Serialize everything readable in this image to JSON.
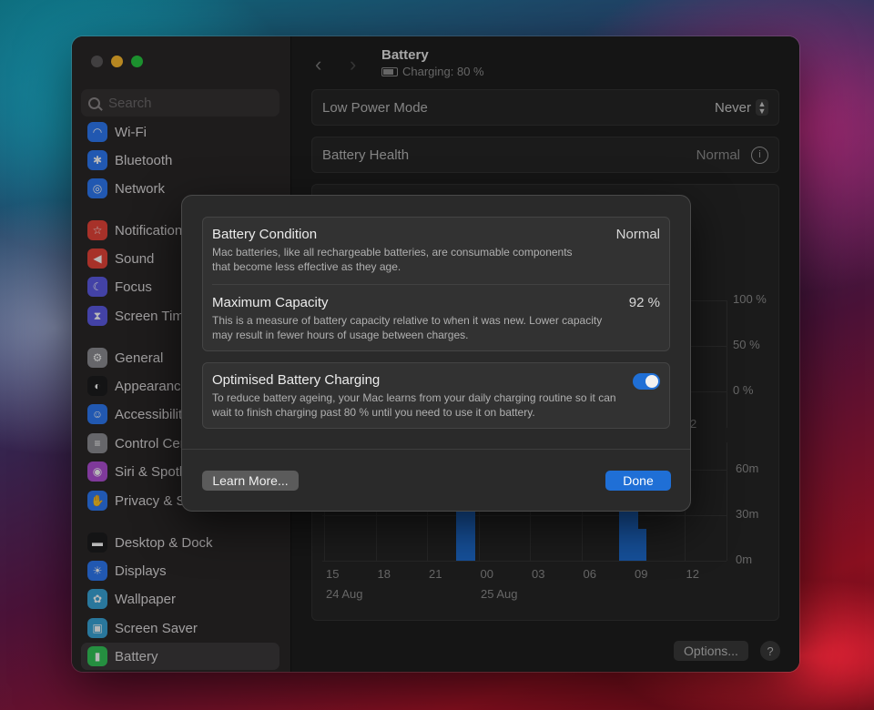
{
  "window": {
    "title": "Battery",
    "subtitle": "Charging: 80 %"
  },
  "sidebar": {
    "search_placeholder": "Search",
    "items": [
      {
        "label": "Wi-Fi",
        "icon": "wifi-icon",
        "color": "#2f7bf5"
      },
      {
        "label": "Bluetooth",
        "icon": "bluetooth-icon",
        "color": "#2f7bf5"
      },
      {
        "label": "Network",
        "icon": "globe-icon",
        "color": "#2f7bf5"
      },
      {
        "label": "Notifications",
        "icon": "bell-icon",
        "color": "#e8443a"
      },
      {
        "label": "Sound",
        "icon": "speaker-icon",
        "color": "#e8443a"
      },
      {
        "label": "Focus",
        "icon": "moon-icon",
        "color": "#5e5ce6"
      },
      {
        "label": "Screen Time",
        "icon": "hourglass-icon",
        "color": "#5e5ce6"
      },
      {
        "label": "General",
        "icon": "gear-icon",
        "color": "#8e8e93"
      },
      {
        "label": "Appearance",
        "icon": "appearance-icon",
        "color": "#1c1c1e"
      },
      {
        "label": "Accessibility",
        "icon": "accessibility-icon",
        "color": "#2f7bf5"
      },
      {
        "label": "Control Centre",
        "icon": "toggles-icon",
        "color": "#8e8e93"
      },
      {
        "label": "Siri & Spotlight",
        "icon": "siri-icon",
        "color": "#b04fd6"
      },
      {
        "label": "Privacy & Security",
        "icon": "hand-icon",
        "color": "#2f7bf5"
      },
      {
        "label": "Desktop & Dock",
        "icon": "dock-icon",
        "color": "#1c1c1e"
      },
      {
        "label": "Displays",
        "icon": "sun-icon",
        "color": "#2f7bf5"
      },
      {
        "label": "Wallpaper",
        "icon": "flower-icon",
        "color": "#3aa6d8"
      },
      {
        "label": "Screen Saver",
        "icon": "screensaver-icon",
        "color": "#3aa6d8"
      },
      {
        "label": "Battery",
        "icon": "battery-icon",
        "color": "#34c759"
      }
    ]
  },
  "settings": {
    "low_power": {
      "label": "Low Power Mode",
      "value": "Never"
    },
    "health": {
      "label": "Battery Health",
      "value": "Normal"
    },
    "segment_fragment": "s",
    "options_button": "Options...",
    "help_button": "?"
  },
  "chart_data": [
    {
      "type": "line",
      "y_ticks": [
        "100 %",
        "50 %",
        "0 %"
      ],
      "x_tick_fragment": "2"
    },
    {
      "type": "bar",
      "y_ticks": [
        "60m",
        "30m",
        "0m"
      ],
      "x_ticks": [
        "15",
        "18",
        "21",
        "00",
        "03",
        "06",
        "09",
        "12"
      ],
      "date_labels": [
        "24 Aug",
        "25 Aug"
      ],
      "ylim": [
        0,
        60
      ],
      "bar_color": "#1f6fd6",
      "bars": [
        {
          "x": 23.0,
          "y": 60
        },
        {
          "x": 23.5,
          "y": 26
        },
        {
          "x": 8.5,
          "y": 32
        },
        {
          "x": 9.0,
          "y": 60
        },
        {
          "x": 9.5,
          "y": 16
        }
      ]
    }
  ],
  "sheet": {
    "condition": {
      "title": "Battery Condition",
      "value": "Normal",
      "description": "Mac batteries, like all rechargeable batteries, are consumable components that become less effective as they age."
    },
    "capacity": {
      "title": "Maximum Capacity",
      "value": "92 %",
      "description": "This is a measure of battery capacity relative to when it was new. Lower capacity may result in fewer hours of usage between charges."
    },
    "optimised": {
      "title": "Optimised Battery Charging",
      "enabled": true,
      "description": "To reduce battery ageing, your Mac learns from your daily charging routine so it can wait to finish charging past 80 % until you need to use it on battery."
    },
    "learn_more": "Learn More...",
    "done": "Done"
  }
}
